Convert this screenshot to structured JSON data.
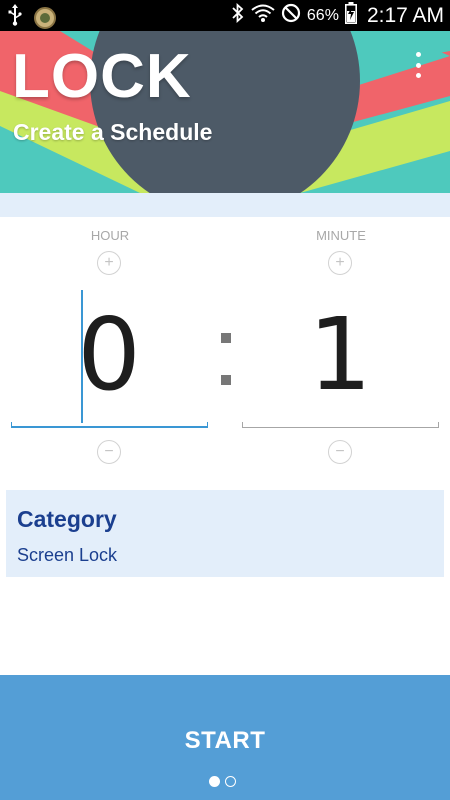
{
  "status_bar": {
    "battery_percent": "66%",
    "time": "2:17 AM",
    "icons": [
      "usb-icon",
      "app-badge-icon",
      "bluetooth-icon",
      "wifi-icon",
      "do-not-disturb-icon",
      "battery-charging-icon"
    ]
  },
  "header": {
    "title": "LOCK",
    "subtitle": "Create a Schedule",
    "menu_icon": "overflow-menu-icon",
    "colors": {
      "teal": "#4ec9bd",
      "coral": "#f0646a",
      "lime": "#c7e85f",
      "slate": "#4d5a67"
    }
  },
  "picker": {
    "hour_label": "HOUR",
    "minute_label": "MINUTE",
    "hour_value": "0",
    "minute_value": "1",
    "increment_symbol": "+",
    "decrement_symbol": "−",
    "accent_color": "#3a97d4"
  },
  "category": {
    "title": "Category",
    "value": "Screen Lock"
  },
  "start": {
    "label": "START",
    "page_count": 2,
    "active_page": 1,
    "color": "#549ed6"
  }
}
